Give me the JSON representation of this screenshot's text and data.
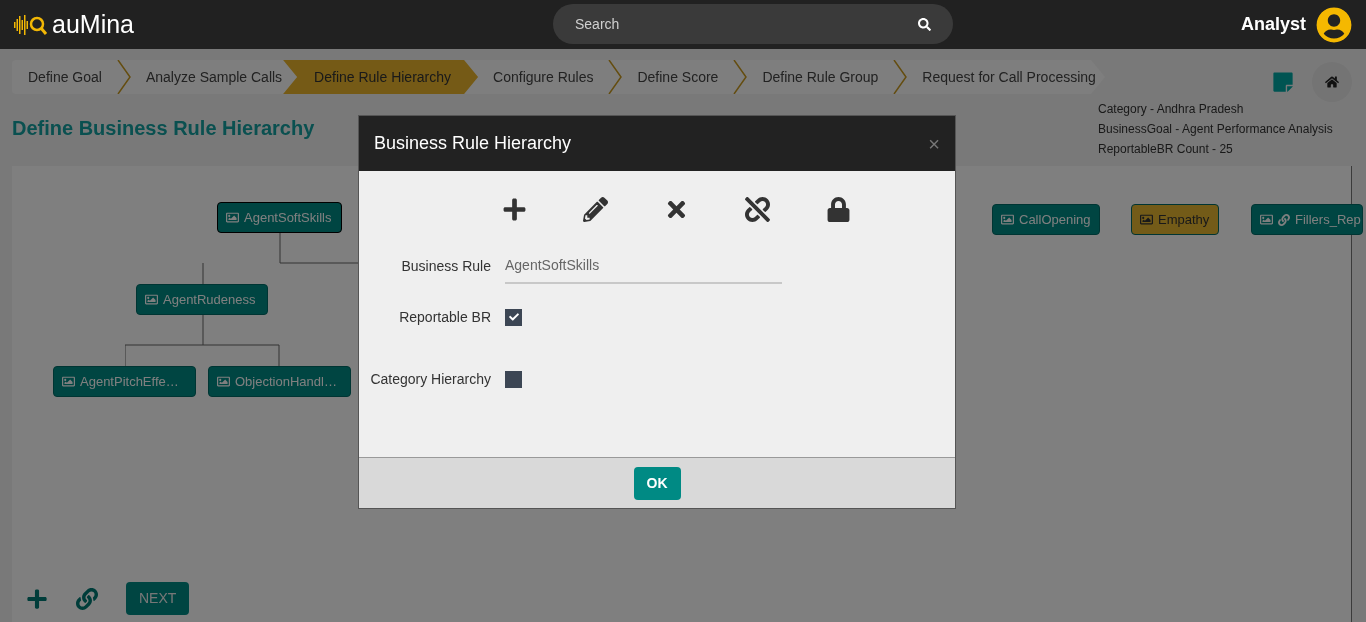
{
  "header": {
    "logo": "auMina",
    "search": {
      "placeholder": "Search"
    },
    "user": "Analyst"
  },
  "breadcrumbs": [
    {
      "label": "Define Goal",
      "selected": false
    },
    {
      "label": "Analyze Sample Calls",
      "selected": false
    },
    {
      "label": "Define Rule Hierarchy",
      "selected": true
    },
    {
      "label": "Configure Rules",
      "selected": false
    },
    {
      "label": "Define Score",
      "selected": false
    },
    {
      "label": "Define Rule Group",
      "selected": false
    },
    {
      "label": "Request for Call Processing",
      "selected": false
    }
  ],
  "page_title": "Define Business Rule Hierarchy",
  "info": [
    "Category - Andhra Pradesh",
    "BusinessGoal - Agent Performance Analysis",
    "ReportableBR Count - 25"
  ],
  "tree": [
    {
      "label": "AgentSoftSkills",
      "kind": "teal",
      "selected": true,
      "linked": false
    },
    {
      "label": "AgentRudeness",
      "kind": "teal",
      "selected": false,
      "linked": false
    },
    {
      "label": "AgentPitchEffe…",
      "kind": "teal",
      "selected": false,
      "linked": false
    },
    {
      "label": "ObjectionHandl…",
      "kind": "teal",
      "selected": false,
      "linked": false
    },
    {
      "label": "CallOpening",
      "kind": "teal",
      "selected": false,
      "linked": false
    },
    {
      "label": "Empathy",
      "kind": "gold",
      "selected": false,
      "linked": false
    },
    {
      "label": "Fillers_Rep",
      "kind": "teal",
      "selected": false,
      "linked": true
    }
  ],
  "next_button": "NEXT",
  "modal": {
    "title": "Business Rule Hierarchy",
    "close": "×",
    "fields": [
      {
        "kind": "text",
        "label": "Business Rule",
        "value": "AgentSoftSkills"
      },
      {
        "kind": "checkbox",
        "label": "Reportable BR",
        "checked": true
      },
      {
        "kind": "checkbox",
        "label": "Category Hierarchy",
        "checked": false
      }
    ],
    "ok": "OK"
  }
}
